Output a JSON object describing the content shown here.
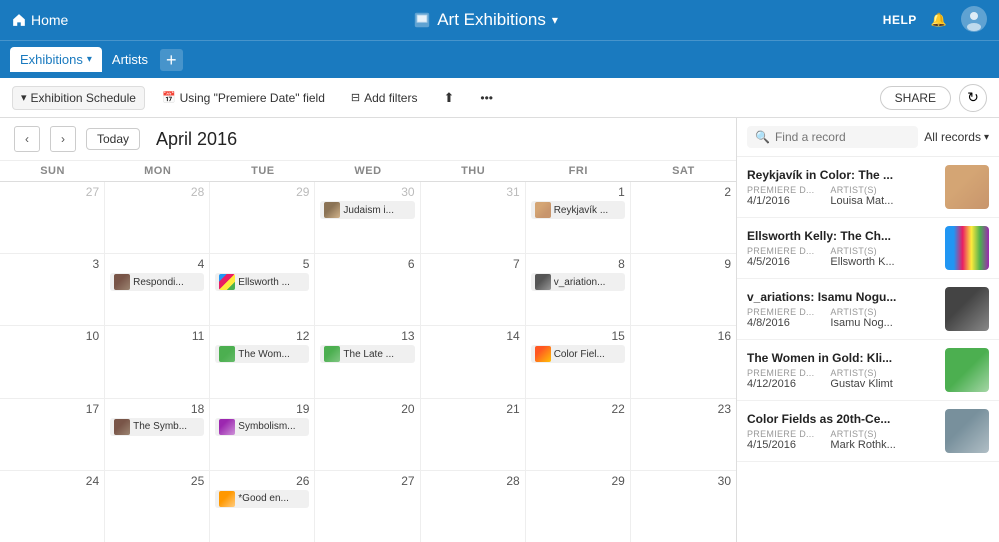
{
  "topnav": {
    "home_label": "Home",
    "app_title": "Art Exhibitions",
    "help_label": "HELP"
  },
  "tabs": {
    "exhibitions_label": "Exhibitions",
    "artists_label": "Artists",
    "add_label": "+"
  },
  "toolbar": {
    "view_label": "Exhibition Schedule",
    "date_field_label": "Using \"Premiere Date\" field",
    "add_filters_label": "Add filters",
    "share_label": "SHARE"
  },
  "calendar": {
    "prev_label": "‹",
    "next_label": "›",
    "today_label": "Today",
    "month_title": "April 2016",
    "day_headers": [
      "SUN",
      "MON",
      "TUE",
      "WED",
      "THU",
      "FRI",
      "SAT"
    ],
    "weeks": [
      {
        "days": [
          {
            "num": "27",
            "other": true,
            "events": []
          },
          {
            "num": "28",
            "other": true,
            "events": []
          },
          {
            "num": "29",
            "other": true,
            "events": []
          },
          {
            "num": "30",
            "other": true,
            "events": [
              {
                "label": "Judaism i...",
                "thumb": "thumb-judaism"
              }
            ]
          },
          {
            "num": "31",
            "other": true,
            "events": []
          },
          {
            "num": "1",
            "events": [
              {
                "label": "Reykjavík ...",
                "thumb": "thumb-reykjavik"
              }
            ]
          },
          {
            "num": "2",
            "events": []
          }
        ]
      },
      {
        "days": [
          {
            "num": "3",
            "events": []
          },
          {
            "num": "4",
            "events": [
              {
                "label": "Respondi...",
                "thumb": "thumb-symb"
              }
            ]
          },
          {
            "num": "5",
            "events": [
              {
                "label": "Ellsworth ...",
                "thumb": "thumb-ellsworth"
              }
            ]
          },
          {
            "num": "6",
            "events": []
          },
          {
            "num": "7",
            "events": []
          },
          {
            "num": "8",
            "events": [
              {
                "label": "v_ariation...",
                "thumb": "thumb-variations"
              }
            ]
          },
          {
            "num": "9",
            "events": []
          }
        ]
      },
      {
        "days": [
          {
            "num": "10",
            "events": []
          },
          {
            "num": "11",
            "events": []
          },
          {
            "num": "12",
            "events": [
              {
                "label": "The Wom...",
                "thumb": "thumb-the-women"
              }
            ]
          },
          {
            "num": "13",
            "events": [
              {
                "label": "The Late ...",
                "thumb": "thumb-late"
              }
            ]
          },
          {
            "num": "14",
            "events": []
          },
          {
            "num": "15",
            "events": [
              {
                "label": "Color Fiel...",
                "thumb": "thumb-color-fields"
              }
            ]
          },
          {
            "num": "16",
            "events": []
          }
        ]
      },
      {
        "days": [
          {
            "num": "17",
            "events": []
          },
          {
            "num": "18",
            "events": [
              {
                "label": "The Symb...",
                "thumb": "thumb-symb"
              }
            ]
          },
          {
            "num": "19",
            "today": true,
            "events": [
              {
                "label": "Symbolism...",
                "thumb": "thumb-symbolism"
              }
            ]
          },
          {
            "num": "20",
            "events": []
          },
          {
            "num": "21",
            "events": []
          },
          {
            "num": "22",
            "events": []
          },
          {
            "num": "23",
            "events": []
          }
        ]
      },
      {
        "days": [
          {
            "num": "24",
            "events": []
          },
          {
            "num": "25",
            "events": []
          },
          {
            "num": "26",
            "events": [
              {
                "label": "*Good en...",
                "thumb": "thumb-good"
              }
            ]
          },
          {
            "num": "27",
            "events": []
          },
          {
            "num": "28",
            "events": []
          },
          {
            "num": "29",
            "events": []
          },
          {
            "num": "30",
            "events": []
          }
        ]
      }
    ]
  },
  "right_panel": {
    "search_placeholder": "Find a record",
    "all_records_label": "All records",
    "records": [
      {
        "title": "Reykjavík in Color: The ...",
        "premiere_date": "4/1/2016",
        "artist": "Louisa Mat...",
        "thumb_class": "thumb-r1"
      },
      {
        "title": "Ellsworth Kelly: The Ch...",
        "premiere_date": "4/5/2016",
        "artist": "Ellsworth K...",
        "thumb_class": "thumb-r2"
      },
      {
        "title": "v_ariations: Isamu Nogu...",
        "premiere_date": "4/8/2016",
        "artist": "Isamu Nog...",
        "thumb_class": "thumb-r3"
      },
      {
        "title": "The Women in Gold: Kli...",
        "premiere_date": "4/12/2016",
        "artist": "Gustav Klimt",
        "thumb_class": "thumb-r4"
      },
      {
        "title": "Color Fields as 20th-Ce...",
        "premiere_date": "4/15/2016",
        "artist": "Mark Rothk...",
        "thumb_class": "thumb-r5"
      }
    ],
    "meta_labels": {
      "premiere_date": "PREMIERE D...",
      "artist": "ARTIST(S)"
    }
  }
}
